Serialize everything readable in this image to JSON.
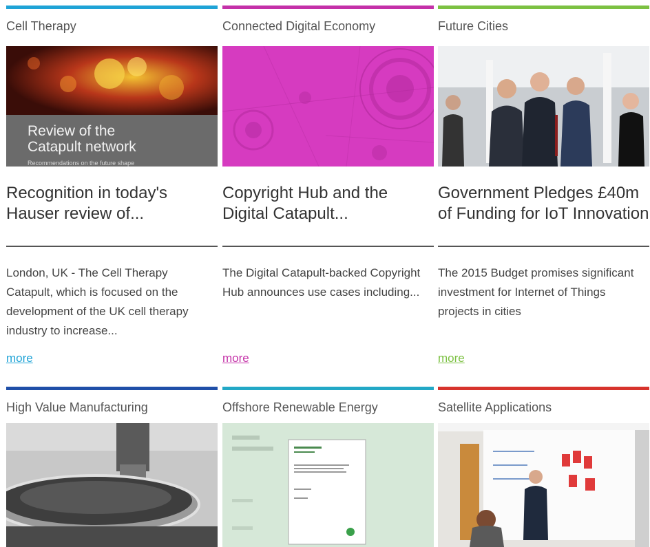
{
  "cards": [
    {
      "category": "Cell Therapy",
      "accent": "#1fa3d6",
      "image": {
        "overlay_title": "Review of the Catapult network",
        "overlay_sub": "Recommendations on the future shape"
      },
      "headline": "Recognition in today's Hauser review of...",
      "description": "London, UK - The Cell Therapy Catapult, which is focused on the development of the UK cell therapy industry to increase...",
      "more_label": "more"
    },
    {
      "category": "Connected Digital Economy",
      "accent": "#c431a8",
      "headline": "Copyright Hub and the Digital Catapult...",
      "description": "The Digital Catapult-backed Copyright Hub announces use cases including...",
      "more_label": "more"
    },
    {
      "category": "Future Cities",
      "accent": "#7cc142",
      "headline": "Government Pledges £40m of Funding for IoT Innovation",
      "description": "The 2015 Budget promises significant investment for Internet of Things projects in cities",
      "more_label": "more"
    },
    {
      "category": "High Value Manufacturing",
      "accent": "#1f4fa8"
    },
    {
      "category": "Offshore Renewable Energy",
      "accent": "#22a8c6"
    },
    {
      "category": "Satellite Applications",
      "accent": "#d7332c"
    }
  ]
}
